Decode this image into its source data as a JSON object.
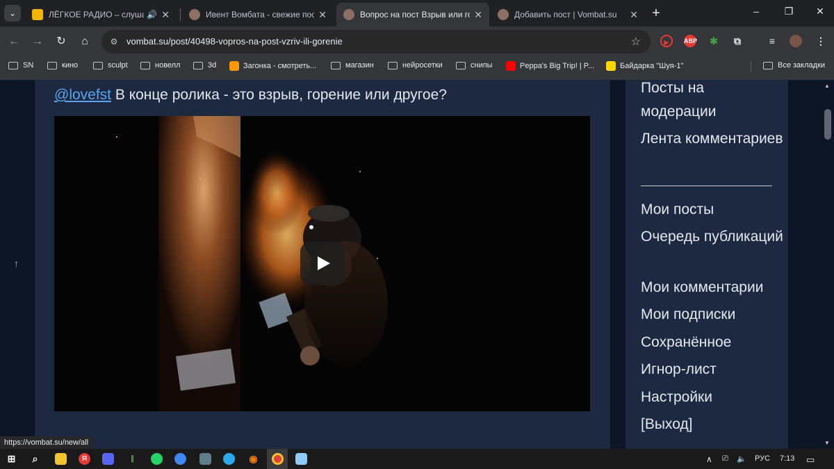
{
  "browser": {
    "tabs": [
      {
        "title": "ЛЁГКОЕ РАДИО – слушать",
        "favicon_color": "#f4b400",
        "sound": "🔊"
      },
      {
        "title": "Ивент Вомбата - свежие посты",
        "favicon_color": "#8d6e63"
      },
      {
        "title": "Вопрос на пост Взрыв или горение",
        "favicon_color": "#8d6e63"
      },
      {
        "title": "Добавить пост | Vombat.su",
        "favicon_color": "#8d6e63"
      }
    ],
    "new_tab": "+",
    "url": "vombat.su/post/40498-vopros-na-post-vzriv-ili-gorenie",
    "extensions": [
      {
        "label": "▶",
        "color": "#e53935"
      },
      {
        "label": "ABP",
        "color": "#e53935"
      },
      {
        "label": "✱",
        "color": "#43a047"
      },
      {
        "label": "⧉",
        "color": "#5f6368"
      }
    ],
    "bookmarks": [
      {
        "label": "SN",
        "kind": "folder"
      },
      {
        "label": "кино",
        "kind": "folder"
      },
      {
        "label": "sculpt",
        "kind": "folder"
      },
      {
        "label": "новелл",
        "kind": "folder"
      },
      {
        "label": "3d",
        "kind": "folder"
      },
      {
        "label": "Загонка - смотреть...",
        "kind": "site",
        "color": "#ff9800"
      },
      {
        "label": "магазин",
        "kind": "folder"
      },
      {
        "label": "нейросетки",
        "kind": "folder"
      },
      {
        "label": "снипы",
        "kind": "folder"
      },
      {
        "label": "Peppa's Big Trip! | P...",
        "kind": "site",
        "color": "#ff0000"
      },
      {
        "label": "Байдарка \"Шуя-1\"",
        "kind": "site",
        "color": "#ffd600"
      }
    ],
    "all_bookmarks": "Все закладки",
    "status_url": "https://vombat.su/new/all"
  },
  "post": {
    "mention": "@lovefst",
    "question": " В конце ролика - это взрыв, горение или другое?"
  },
  "sidebar": {
    "items_top": [
      "Посты на модерации",
      "Лента комментариев"
    ],
    "items_bottom": [
      "Мои посты",
      "Очередь публикаций",
      "Мои комментарии",
      "Мои подписки",
      "Сохранённое",
      "Игнор-лист",
      "Настройки",
      "[Выход]"
    ]
  },
  "taskbar": {
    "lang": "РУС",
    "time": "7:13"
  },
  "colors": {
    "page_bg": "#0d1526",
    "panel_bg": "#1c2941",
    "link": "#59a5ef"
  }
}
